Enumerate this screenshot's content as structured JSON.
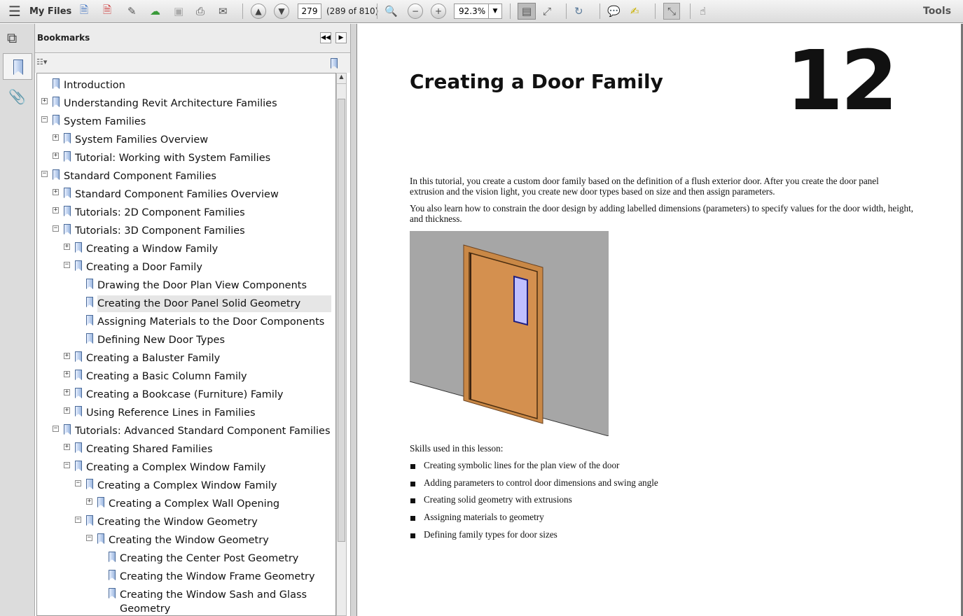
{
  "toolbar": {
    "menu_label": "My Files",
    "page_number": "279",
    "page_count": "(289 of 810)",
    "zoom": "92.3%",
    "tools_label": "Tools",
    "icons": [
      "create-pdf-icon",
      "convert-icon",
      "edit-icon",
      "cloud-upload-icon",
      "save-icon",
      "print-icon",
      "email-icon",
      "prev-page-icon",
      "next-page-icon",
      "zoom-tool-icon",
      "zoom-out-icon",
      "zoom-in-icon",
      "fit-page-icon",
      "fit-width-icon",
      "rotate-icon",
      "comment-icon",
      "highlight-text-icon",
      "fullscreen-icon",
      "hand-tool-icon"
    ]
  },
  "panel": {
    "title": "Bookmarks"
  },
  "bookmarks": [
    {
      "label": "Introduction",
      "level": 0,
      "exp": ""
    },
    {
      "label": "Understanding Revit Architecture Families",
      "level": 0,
      "exp": "+"
    },
    {
      "label": "System Families",
      "level": 0,
      "exp": "-"
    },
    {
      "label": "System Families Overview",
      "level": 1,
      "exp": "+"
    },
    {
      "label": "Tutorial: Working with System Families",
      "level": 1,
      "exp": "+"
    },
    {
      "label": "Standard Component Families",
      "level": 0,
      "exp": "-"
    },
    {
      "label": "Standard Component Families Overview",
      "level": 1,
      "exp": "+"
    },
    {
      "label": "Tutorials: 2D Component Families",
      "level": 1,
      "exp": "+"
    },
    {
      "label": "Tutorials: 3D Component Families",
      "level": 1,
      "exp": "-"
    },
    {
      "label": "Creating a Window Family",
      "level": 2,
      "exp": "+"
    },
    {
      "label": "Creating a Door Family",
      "level": 2,
      "exp": "-"
    },
    {
      "label": "Drawing the Door Plan View Components",
      "level": 3,
      "exp": ""
    },
    {
      "label": "Creating the Door Panel Solid Geometry",
      "level": 3,
      "exp": "",
      "selected": true
    },
    {
      "label": "Assigning Materials to the Door Components",
      "level": 3,
      "exp": ""
    },
    {
      "label": "Defining New Door Types",
      "level": 3,
      "exp": ""
    },
    {
      "label": "Creating a Baluster Family",
      "level": 2,
      "exp": "+"
    },
    {
      "label": "Creating a Basic Column Family",
      "level": 2,
      "exp": "+"
    },
    {
      "label": "Creating a Bookcase (Furniture) Family",
      "level": 2,
      "exp": "+"
    },
    {
      "label": "Using Reference Lines in Families",
      "level": 2,
      "exp": "+"
    },
    {
      "label": "Tutorials: Advanced Standard Component Families",
      "level": 1,
      "exp": "-"
    },
    {
      "label": "Creating Shared Families",
      "level": 2,
      "exp": "+"
    },
    {
      "label": "Creating a Complex Window Family",
      "level": 2,
      "exp": "-"
    },
    {
      "label": "Creating a Complex Window Family",
      "level": 3,
      "exp": "-"
    },
    {
      "label": "Creating a Complex Wall Opening",
      "level": 4,
      "exp": "+"
    },
    {
      "label": "Creating the Window Geometry",
      "level": 3,
      "exp": "-"
    },
    {
      "label": "Creating the Window Geometry",
      "level": 4,
      "exp": "-"
    },
    {
      "label": "Creating the Center Post Geometry",
      "level": 5,
      "exp": ""
    },
    {
      "label": "Creating the Window Frame Geometry",
      "level": 5,
      "exp": ""
    },
    {
      "label": "Creating the Window Sash and Glass",
      "level": 5,
      "exp": "",
      "cont": "Geometry"
    }
  ],
  "document": {
    "chapter_title": "Creating a Door Family",
    "chapter_number": "12",
    "para1": "In this tutorial, you create a custom door family based on the definition of a flush exterior door. After you create the door panel extrusion and the vision light, you create new door types based on size and then assign parameters.",
    "para2": "You also learn how to constrain the door design by adding labelled dimensions (parameters) to specify values for the door width, height, and thickness.",
    "skills_heading": "Skills used in this lesson:",
    "skills": [
      "Creating symbolic lines for the plan view of the door",
      "Adding parameters to control door dimensions and swing angle",
      "Creating solid geometry with extrusions",
      "Assigning materials to geometry",
      "Defining family types for door sizes"
    ]
  }
}
